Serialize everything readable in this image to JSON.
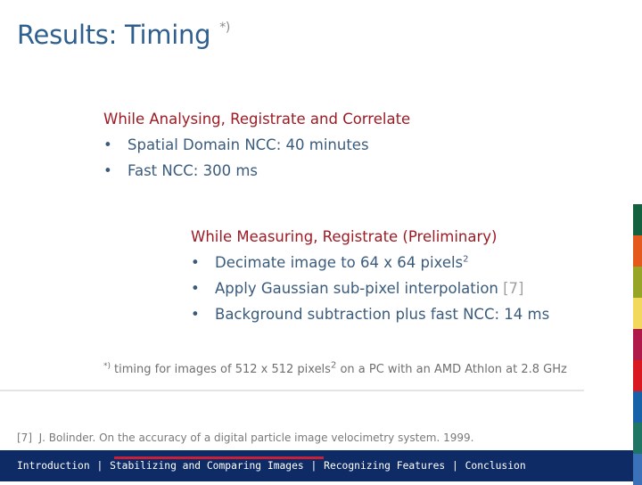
{
  "title": {
    "text": "Results: Timing",
    "footnote_mark": "*)"
  },
  "section1": {
    "heading": "While Analysing, Registrate and Correlate",
    "bullet": "•",
    "items": [
      {
        "text": "Spatial Domain NCC: 40 minutes"
      },
      {
        "text": "Fast NCC: 300 ms"
      }
    ]
  },
  "section2": {
    "heading": "While Measuring, Registrate (Preliminary)",
    "bullet": "•",
    "items": [
      {
        "text": "Decimate image to 64 x 64 pixels",
        "sup": "2"
      },
      {
        "text": "Apply Gaussian sub-pixel interpolation ",
        "ref": "[7]"
      },
      {
        "text": "Background subtraction plus fast NCC: 14 ms"
      }
    ]
  },
  "footnote": {
    "mark": "*)",
    "text_before": "timing for images of 512 x 512 pixels",
    "sup": "2",
    "text_after": " on a PC with an AMD Athlon at 2.8 GHz"
  },
  "reference": "[7]  J. Bolinder. On the accuracy of a digital particle image velocimetry system. 1999.",
  "navigation": {
    "separator": "|",
    "items": [
      {
        "label": "Introduction",
        "active": false
      },
      {
        "label": "Stabilizing and Comparing Images",
        "active": true
      },
      {
        "label": "Recognizing Features",
        "active": false
      },
      {
        "label": "Conclusion",
        "active": false
      }
    ]
  },
  "colors": {
    "title": "#2f5f8f",
    "heading": "#9e1b24",
    "body": "#3b5b7c",
    "navbar": "#0f2b66",
    "active_indicator": "#c8203a",
    "colorbar": [
      "#13613f",
      "#e35a1c",
      "#96a526",
      "#f2d95c",
      "#b01a4a",
      "#d8191f",
      "#1661a8",
      "#1f7564",
      "#3b71b8"
    ]
  }
}
